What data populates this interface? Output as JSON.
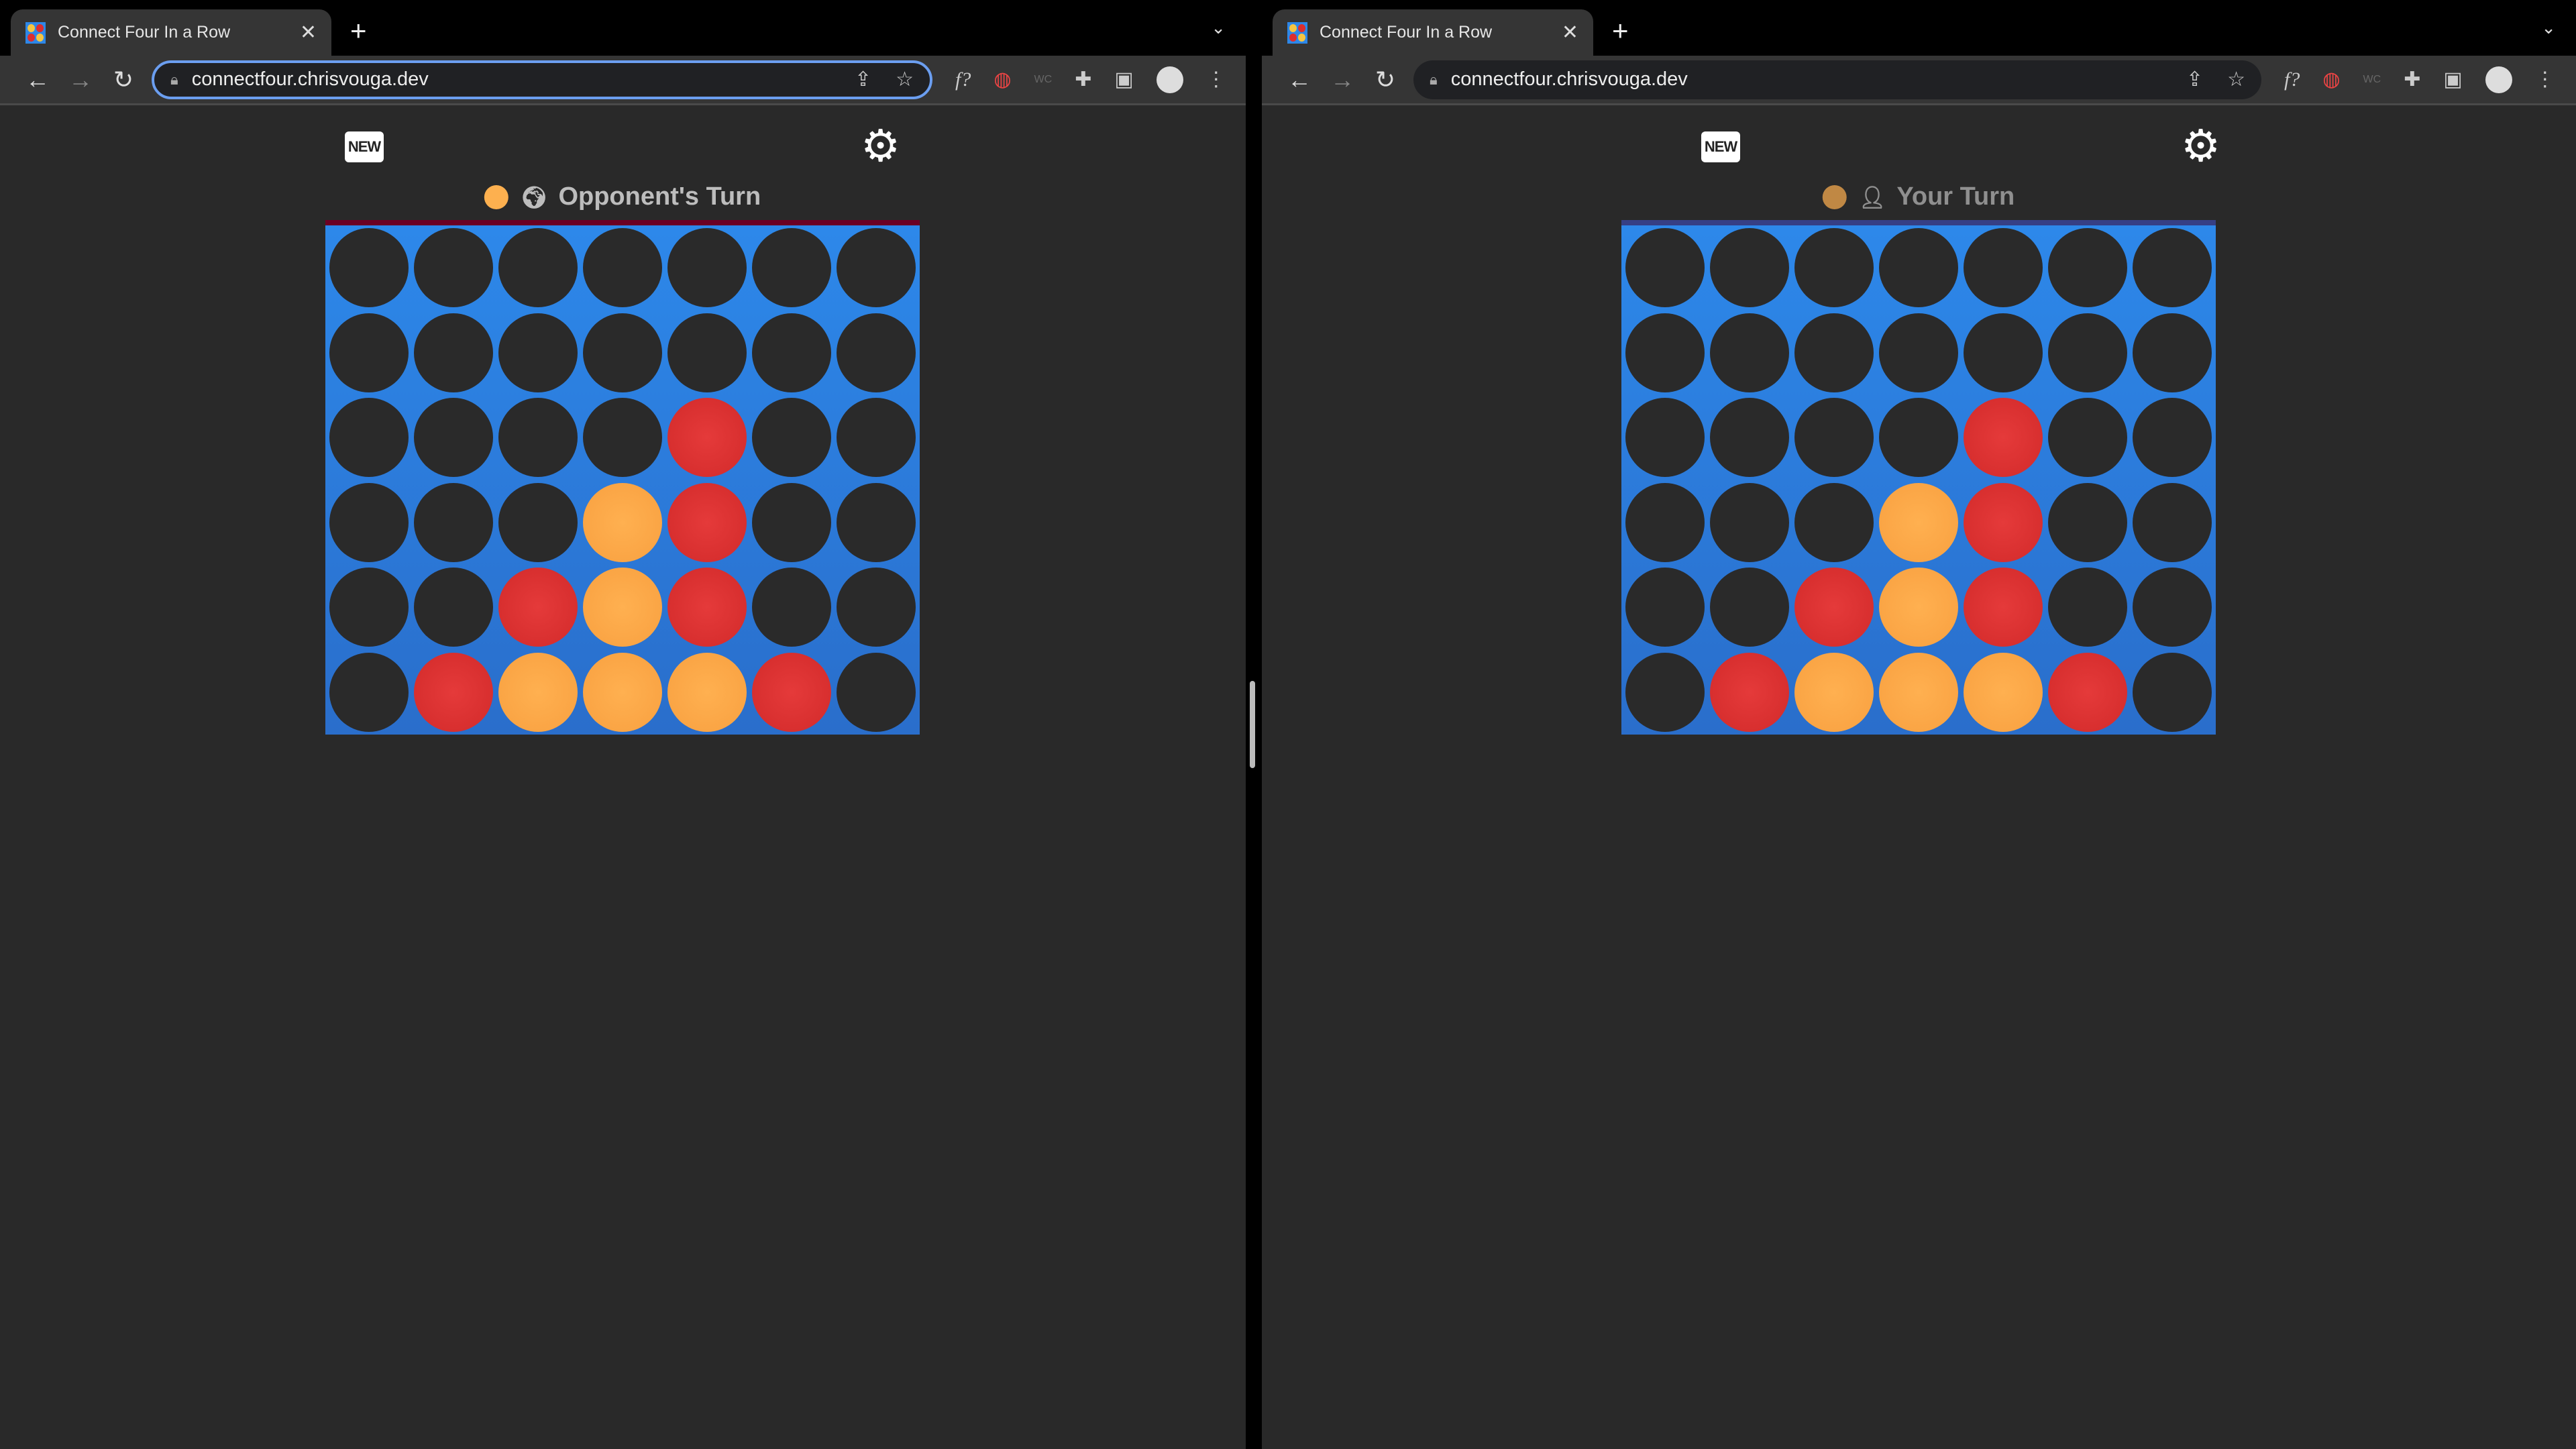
{
  "colors": {
    "red": "#dd2e2e",
    "orange": "#fdab47",
    "empty": "#2a2a2a",
    "board": "#2d87e8"
  },
  "windows": [
    {
      "tab_title": "Connect Four In a Row",
      "url": "connectfour.chrisvouga.dev",
      "new_label": "NEW",
      "status": {
        "text": "Opponent's Turn",
        "icon": "globe-icon",
        "disc_color": "#fdb04f",
        "text_color": "#bdbdbd",
        "bar_color": "#6b0024"
      }
    },
    {
      "tab_title": "Connect Four In a Row",
      "url": "connectfour.chrisvouga.dev",
      "new_label": "NEW",
      "status": {
        "text": "Your Turn",
        "icon": "person-icon",
        "disc_color": "#c08844",
        "text_color": "#8f8f8f",
        "bar_color": "#363f85"
      }
    }
  ],
  "board": [
    [
      ".",
      ".",
      ".",
      ".",
      ".",
      ".",
      "."
    ],
    [
      ".",
      ".",
      ".",
      ".",
      ".",
      ".",
      "."
    ],
    [
      ".",
      ".",
      ".",
      ".",
      "R",
      ".",
      "."
    ],
    [
      ".",
      ".",
      ".",
      "O",
      "R",
      ".",
      "."
    ],
    [
      ".",
      ".",
      "R",
      "O",
      "R",
      ".",
      "."
    ],
    [
      ".",
      "R",
      "O",
      "O",
      "O",
      "R",
      "."
    ]
  ]
}
